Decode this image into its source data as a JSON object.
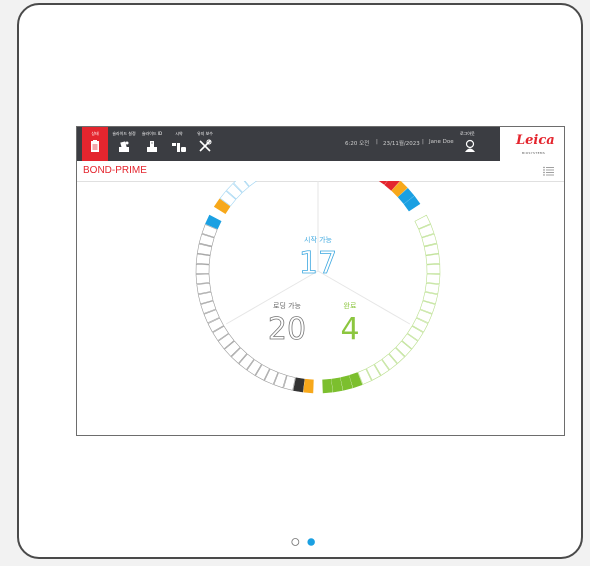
{
  "nav": {
    "tabs": [
      {
        "label": "상태",
        "icon": "status-icon",
        "active": true
      },
      {
        "label": "슬라이드 설정",
        "icon": "slide-setup-icon",
        "active": false
      },
      {
        "label": "슬라이드 ID",
        "icon": "slide-id-icon",
        "active": false
      },
      {
        "label": "시약",
        "icon": "reagents-icon",
        "active": false
      },
      {
        "label": "유지 보수",
        "icon": "maintenance-icon",
        "active": false
      }
    ]
  },
  "status_bar": {
    "time": "6:20 오전",
    "date": "23/11월/2023",
    "user": "Jane Doe",
    "login_label": "로그아웃"
  },
  "brand": {
    "name": "Leica",
    "sub": "BIOSYSTEMS",
    "color": "#e4252e"
  },
  "app": {
    "title": "BOND-PRIME"
  },
  "dial": {
    "start": {
      "label": "시작 가능",
      "count": "17",
      "color": "#3fa9e0"
    },
    "loaded": {
      "label": "로딩 가능",
      "count": "20",
      "color": "#888888"
    },
    "done": {
      "label": "완료",
      "count": "4",
      "color": "#8cc63f"
    }
  },
  "pager": {
    "pages": 2,
    "current": 2,
    "active_color": "#1ba0e2"
  }
}
